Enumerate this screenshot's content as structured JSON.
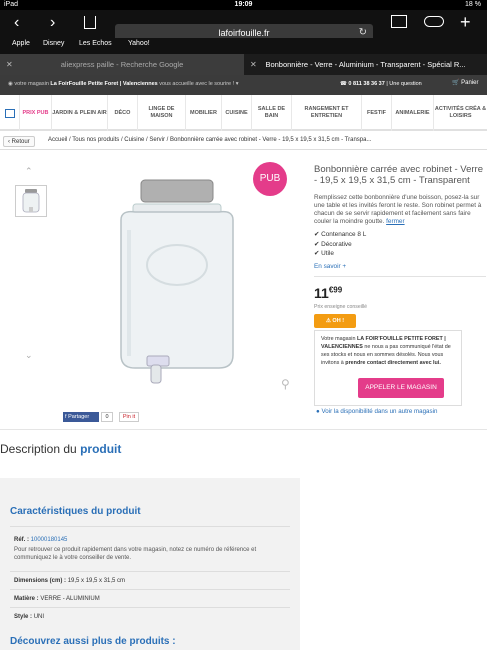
{
  "status": {
    "left": "iPad",
    "time": "19:09",
    "battery": "18 %"
  },
  "browser": {
    "url": "lafoirfouille.fr",
    "favorites": [
      "Apple",
      "Disney",
      "Les Echos",
      "Yahoo!"
    ],
    "tabs": [
      {
        "label": "aliexpress paille - Recherche Google"
      },
      {
        "label": "Bonbonnière - Verre - Aluminium - Transparent - Spécial R..."
      }
    ]
  },
  "sitebar": {
    "store_prefix": "votre magasin",
    "store_name": "La FoirFouille Petite Foret | Valenciennes",
    "store_suffix": "vous accueille avec le sourire !",
    "phone": "0 811 38 36 37",
    "question": "| Une question",
    "cart": "Panier"
  },
  "menu": [
    {
      "label": "PRIX PUB"
    },
    {
      "label": "JARDIN & PLEIN AIR"
    },
    {
      "label": "DÉCO"
    },
    {
      "label": "LINGE DE MAISON"
    },
    {
      "label": "MOBILIER"
    },
    {
      "label": "CUISINE"
    },
    {
      "label": "SALLE DE BAIN"
    },
    {
      "label": "RANGEMENT ET ENTRETIEN"
    },
    {
      "label": "FESTIF"
    },
    {
      "label": "ANIMALERIE"
    },
    {
      "label": "ACTIVITÉS CRÉA & LOISIRS"
    }
  ],
  "breadcrumb": {
    "back": "Retour",
    "items": [
      "Accueil",
      "Tous nos produits",
      "Cuisine",
      "Servir",
      "Bonbonnière carrée avec robinet - Verre - 19,5 x 19,5 x 31,5 cm - Transpa..."
    ]
  },
  "product": {
    "pub_badge": "PUB",
    "title": "Bonbonnière carrée avec robinet - Verre - 19,5 x 19,5 x 31,5 cm - Transparent",
    "description": "Remplissez cette bonbonnière d'une boisson, posez-la sur une table et les invités feront le reste. Son robinet permet à chacun de se servir rapidement et facilement sans faire couler la moindre goutte.",
    "close_link": "fermer",
    "features": [
      "Contenance 8 L",
      "Décorative",
      "Utile"
    ],
    "more": "En savoir +",
    "price_int": "11",
    "price_cents": "€99",
    "price_note": "Prix enseigne conseillé",
    "stock_badge": "OH !",
    "stock_prefix": "Votre magasin",
    "stock_store": "LA FOIR'FOUILLE PETITE FORET | VALENCIENNES",
    "stock_text": "ne nous a pas communiqué l'état de ses stocks et nous en sommes désolés. Nous vous invitons à",
    "stock_bold": "prendre contact directement avec lui.",
    "call_button": "APPELER LE MAGASIN",
    "availability": "Voir la disponibilité dans un autre magasin",
    "share_label": "Partager",
    "share_count": "0",
    "pin_label": "Pin it"
  },
  "description": {
    "title_plain": "Description du",
    "title_bold": "produit",
    "features_title": "Caractéristiques du produit",
    "ref_label": "Réf. :",
    "ref_value": "10000180145",
    "ref_help": "Pour retrouver ce produit rapidement dans votre magasin, notez ce numéro de référence et communiquez le à votre conseiller de vente.",
    "dims_label": "Dimensions (cm) :",
    "dims_value": "19,5 x 19,5 x 31,5 cm",
    "material_label": "Matière :",
    "material_value": "VERRE - ALUMINIUM",
    "style_label": "Style :",
    "style_value": "UNI",
    "discover": "Découvrez aussi plus de produits :"
  }
}
